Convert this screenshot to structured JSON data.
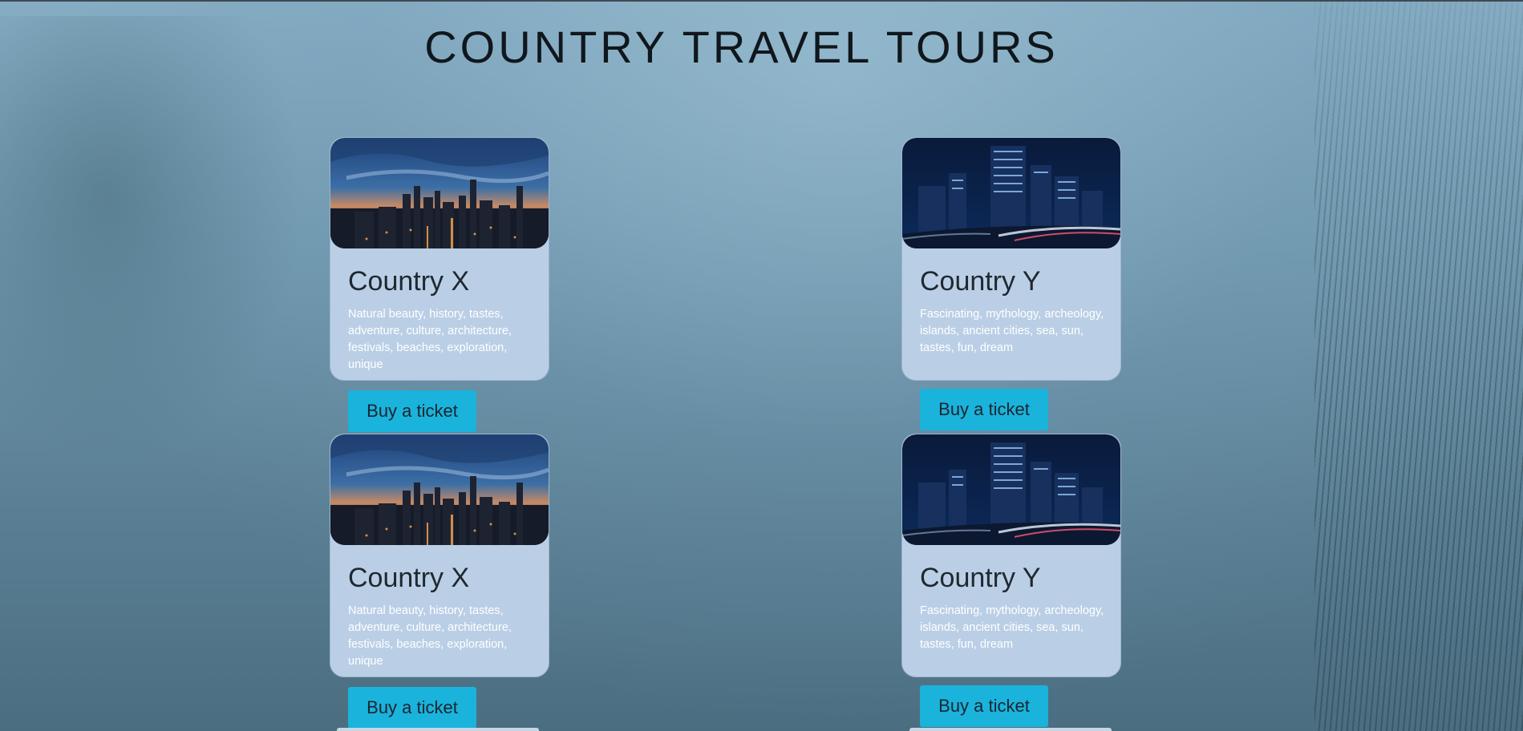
{
  "page": {
    "title": "COUNTRY TRAVEL TOURS"
  },
  "cards": [
    {
      "title": "Country X",
      "description": "Natural beauty, history, tastes, adventure, culture, architecture, festivals, beaches, exploration, unique",
      "button": "Buy a ticket",
      "image": "city-skyline-dusk-photo"
    },
    {
      "title": "Country Y",
      "description": "Fascinating, mythology, archeology, islands, ancient cities, sea, sun, tastes, fun, dream",
      "button": "Buy a ticket",
      "image": "city-skyscrapers-night-photo"
    },
    {
      "title": "Country X",
      "description": "Natural beauty, history, tastes, adventure, culture, architecture, festivals, beaches, exploration, unique",
      "button": "Buy a ticket",
      "image": "city-skyline-dusk-photo"
    },
    {
      "title": "Country Y",
      "description": "Fascinating, mythology, archeology, islands, ancient cities, sea, sun, tastes, fun, dream",
      "button": "Buy a ticket",
      "image": "city-skyscrapers-night-photo"
    }
  ],
  "colors": {
    "card_background": "#bacfe6",
    "button_background": "#1ab3dc",
    "title_text": "#10171c"
  }
}
